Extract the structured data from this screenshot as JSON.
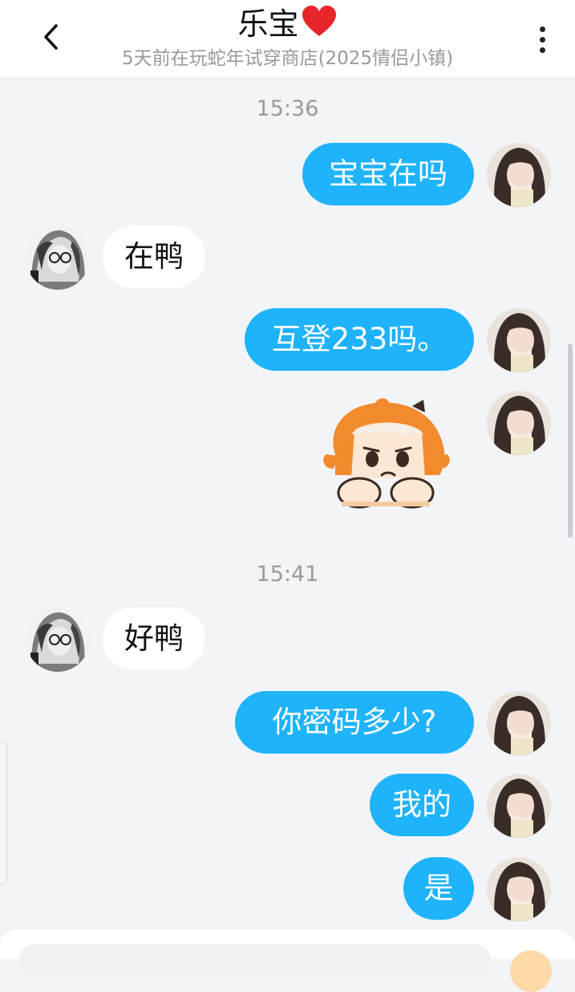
{
  "header": {
    "title": "乐宝",
    "subtitle": "5天前在玩蛇年试穿商店(2025情侣小镇)",
    "back_icon": "chevron-left-icon",
    "more_icon": "more-vertical-icon",
    "heart_icon": "red-heart-icon"
  },
  "colors": {
    "my_bubble": "#1fb3fb",
    "their_bubble": "#ffffff",
    "background": "#f3f4f7",
    "heart": "#e8252b"
  },
  "chat": {
    "time1": "15:36",
    "time2": "15:41",
    "messages": [
      {
        "from": "me",
        "text": "宝宝在吗"
      },
      {
        "from": "them",
        "text": "在鸭"
      },
      {
        "from": "me",
        "text": "互登233吗。"
      },
      {
        "from": "me",
        "sticker": "sad-orange-hair-girl-sticker"
      },
      {
        "from": "them",
        "text": "好鸭"
      },
      {
        "from": "me",
        "text": "你密码多少?"
      },
      {
        "from": "me",
        "text": "我的"
      },
      {
        "from": "me",
        "text": "是"
      }
    ]
  }
}
